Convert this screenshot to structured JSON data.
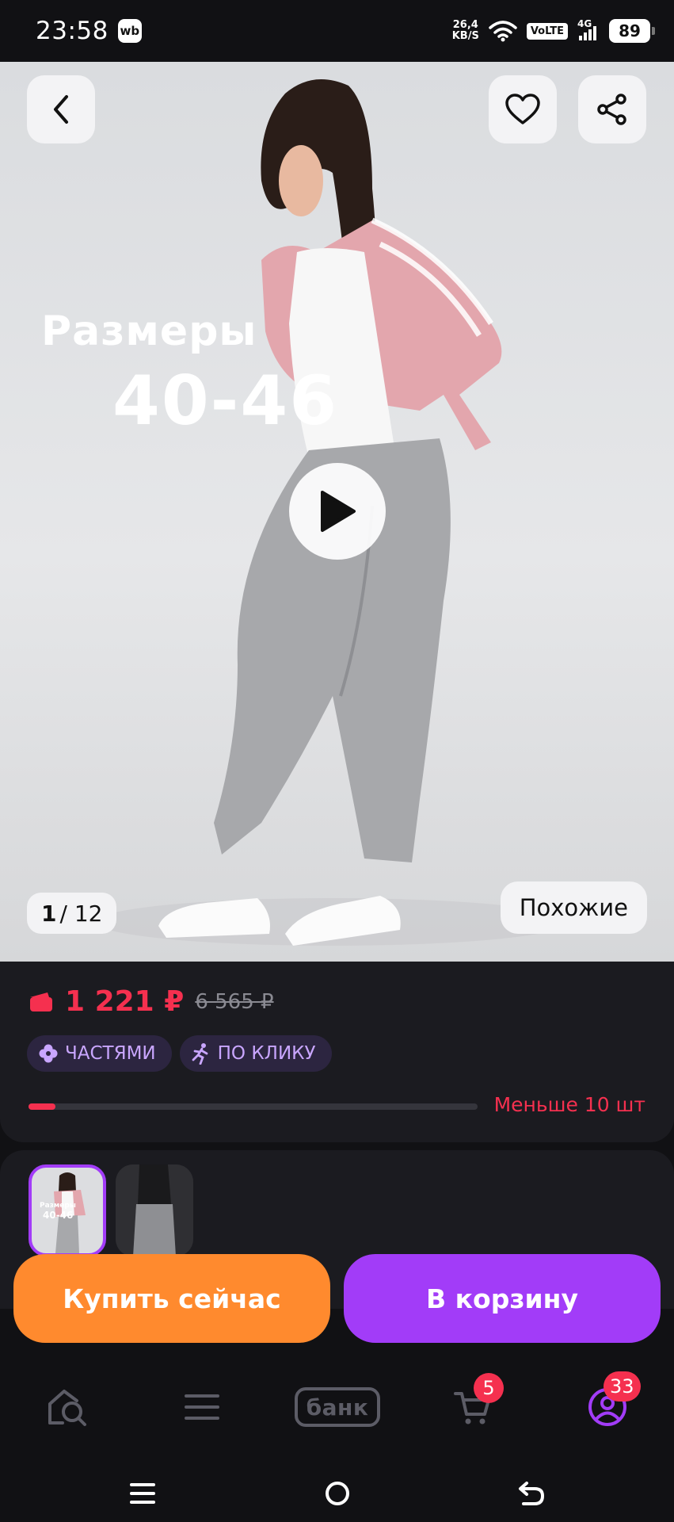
{
  "status_bar": {
    "time": "23:58",
    "app_badge": "wb",
    "net_speed_value": "26,4",
    "net_speed_unit": "KB/S",
    "volte": "VoLTE",
    "network": "4G",
    "battery": "89"
  },
  "gallery": {
    "promo_word": "Размеры",
    "promo_range": "40-46",
    "current_index": "1",
    "total": "/ 12",
    "similar_label": "Похожие"
  },
  "price": {
    "current": "1 221 ₽",
    "old": "6 565 ₽",
    "accent_color": "#f5304f"
  },
  "chips": [
    {
      "icon": "clover-icon",
      "label": "ЧАСТЯМИ"
    },
    {
      "icon": "running-person-icon",
      "label": "ПО КЛИКУ"
    }
  ],
  "stock": {
    "label": "Меньше 10 шт",
    "level_fraction": 0.06
  },
  "actions": {
    "buy_now": "Купить сейчас",
    "add_to_cart": "В корзину",
    "buy_color": "#ff8a2e",
    "cart_color": "#a23cf8"
  },
  "bottom_nav": {
    "home_icon": "home-search-icon",
    "catalog_icon": "menu-icon",
    "bank_label": "банк",
    "cart_badge": "5",
    "profile_badge": "33"
  }
}
